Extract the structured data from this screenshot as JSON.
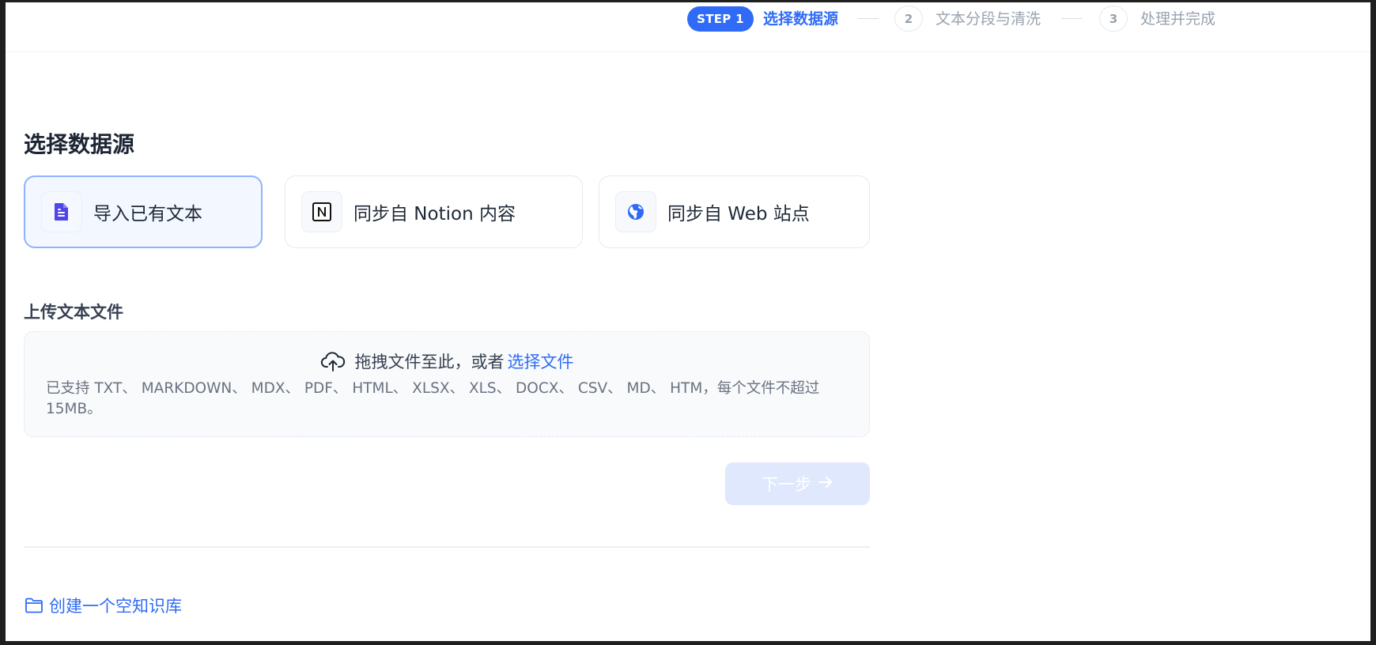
{
  "stepper": {
    "step1_badge": "STEP 1",
    "step1_label": "选择数据源",
    "step2_num": "2",
    "step2_label": "文本分段与清洗",
    "step3_num": "3",
    "step3_label": "处理并完成"
  },
  "main": {
    "title": "选择数据源",
    "sources": [
      {
        "label": "导入已有文本",
        "icon": "file-text-icon",
        "selected": true
      },
      {
        "label": "同步自 Notion 内容",
        "icon": "notion-icon",
        "selected": false
      },
      {
        "label": "同步自 Web 站点",
        "icon": "globe-icon",
        "selected": false
      }
    ],
    "upload": {
      "title": "上传文本文件",
      "drop_text": "拖拽文件至此，或者",
      "select_link": "选择文件",
      "supported_text": "已支持 TXT、 MARKDOWN、 MDX、 PDF、 HTML、 XLSX、 XLS、 DOCX、 CSV、 MD、 HTM，每个文件不超过 15MB。"
    },
    "next_button": "下一步",
    "create_empty": "创建一个空知识库"
  },
  "colors": {
    "accent": "#2f6bf6",
    "disabled_button": "#dfe8fd"
  }
}
